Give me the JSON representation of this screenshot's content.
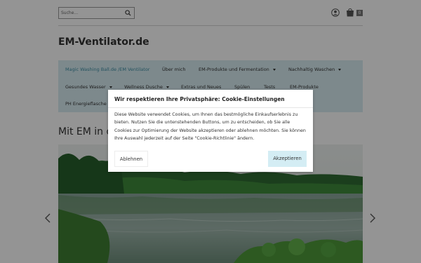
{
  "header": {
    "search_placeholder": "Suche...",
    "cart_count": "0",
    "site_title": "EM-Ventilator.de"
  },
  "nav": {
    "items": [
      {
        "label": "Magic Washing Ball.de /EM Ventilator",
        "active": true
      },
      {
        "label": "Über mich"
      },
      {
        "label": "EM-Produkte und Fermentation",
        "has_dropdown": true
      },
      {
        "label": "Nachhaltig Waschen",
        "has_dropdown": true
      },
      {
        "label": "Gesundes Wasser",
        "has_dropdown": true
      },
      {
        "label": "Wellness Dusche",
        "has_dropdown": true
      },
      {
        "label": "Extras und Neues"
      },
      {
        "label": "Spülen"
      },
      {
        "label": "Tests"
      },
      {
        "label": "EM-Produkte"
      },
      {
        "label": "PH Energieflasche"
      }
    ]
  },
  "content": {
    "heading": "Mit EM in di"
  },
  "cookie": {
    "title": "Wir respektieren Ihre Privatsphäre: Cookie-Einstellungen",
    "body": "Diese Website verwendet Cookies, um Ihnen das bestmögliche Einkaufserlebnis zu bieten. Nutzen Sie die untenstehenden Buttons, um zu entscheiden, ob Sie alle Cookies zur Optimierung der Website akzeptieren oder ablehnen möchten. Sie können Ihre Auswahl jederzeit auf der Seite \"Cookie-Richtlinie\" ändern.",
    "decline_label": "Ablehnen",
    "accept_label": "Akzeptieren"
  },
  "colors": {
    "nav_background": "#d8ecf2",
    "nav_active": "#3d8ea3",
    "accept_button": "#d4edf4"
  },
  "icons": [
    "search-icon",
    "account-icon",
    "cart-icon",
    "chevron-left-icon",
    "chevron-right-icon"
  ]
}
